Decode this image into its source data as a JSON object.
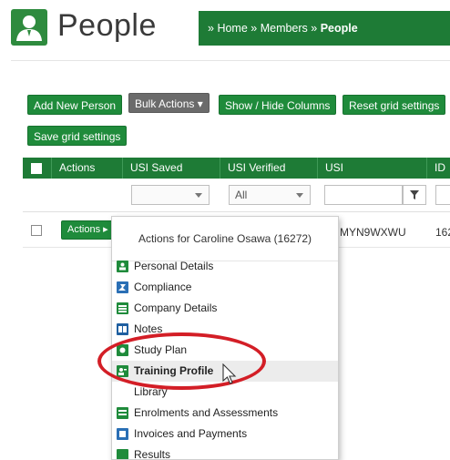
{
  "header": {
    "title": "People",
    "breadcrumb": {
      "sep": "»",
      "home": "Home",
      "members": "Members",
      "current": "People"
    }
  },
  "toolbar": {
    "add_new_person": "Add New Person",
    "bulk_actions": "Bulk Actions ▾",
    "show_hide_columns": "Show / Hide Columns",
    "reset_grid": "Reset grid settings",
    "save_grid": "Save grid settings"
  },
  "grid": {
    "columns": [
      "Actions",
      "USI Saved",
      "USI Verified",
      "USI",
      "ID"
    ],
    "filters": {
      "usi_verified": "All"
    },
    "rows": [
      {
        "actions_label": "Actions ▸",
        "usi": "MYN9WXWU",
        "id": "162"
      }
    ]
  },
  "menu": {
    "heading": "Actions for Caroline Osawa (16272)",
    "items": [
      {
        "label": "Personal Details",
        "icon": "person-details-icon"
      },
      {
        "label": "Compliance",
        "icon": "compliance-icon"
      },
      {
        "label": "Company Details",
        "icon": "company-icon"
      },
      {
        "label": "Notes",
        "icon": "notes-icon"
      },
      {
        "label": "Study Plan",
        "icon": "study-plan-icon"
      },
      {
        "label": "Training Profile",
        "icon": "training-profile-icon",
        "active": true
      },
      {
        "label": "Library",
        "icon": "library-icon"
      },
      {
        "label": "Enrolments and Assessments",
        "icon": "enrolments-icon"
      },
      {
        "label": "Invoices and Payments",
        "icon": "invoices-icon"
      },
      {
        "label": "Results",
        "icon": "results-icon"
      }
    ]
  },
  "colors": {
    "brand_green": "#1e7b36",
    "button_green": "#1f8b3b",
    "button_grey": "#6b6b6b",
    "highlight_red": "#d31e26"
  }
}
